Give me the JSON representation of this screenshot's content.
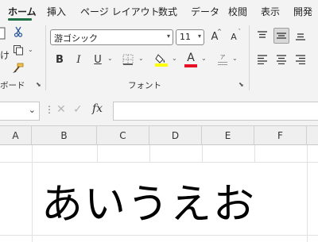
{
  "tabs": [
    "ホーム",
    "挿入",
    "ページ レイアウト",
    "数式",
    "データ",
    "校閲",
    "表示",
    "開発"
  ],
  "clipboard": {
    "paste_partial": "け",
    "group_label": "ボード"
  },
  "font": {
    "name": "游ゴシック",
    "size": "11",
    "group_label": "フォント",
    "bold": "B",
    "italic": "I",
    "underline": "U",
    "font_color_label": "A",
    "grow": "A",
    "shrink": "A",
    "phonetic": "ア",
    "fill_color": "#ffff00",
    "text_color": "#e81123"
  },
  "formula_bar": {
    "fx": "fx",
    "value": ""
  },
  "columns": [
    "A",
    "B",
    "C",
    "D",
    "E",
    "F"
  ],
  "cell": {
    "text": "あいうえお"
  },
  "accent": "#1e7145"
}
